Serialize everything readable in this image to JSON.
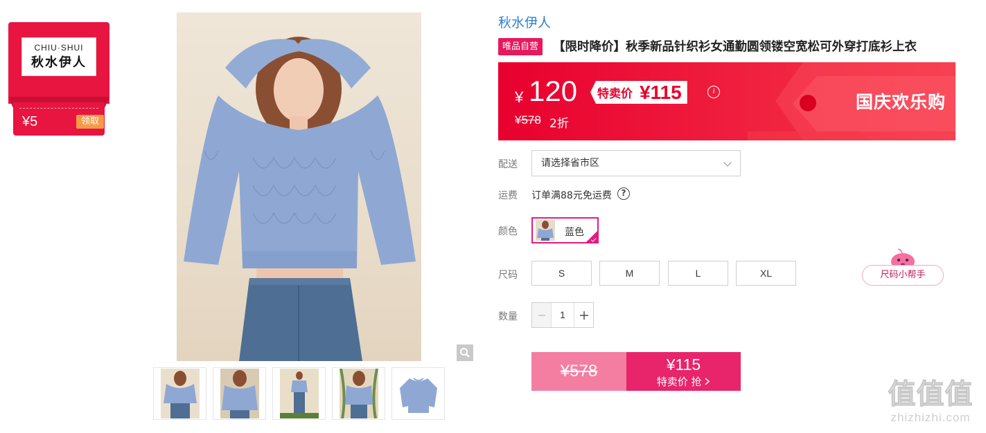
{
  "coupon": {
    "logo_en": "CHIU·SHUI",
    "logo_cn": "秋水伊人",
    "value": "¥5",
    "claim_label": "领取"
  },
  "product": {
    "brand": "秋水伊人",
    "tag": "唯品自营",
    "title": "【限时降价】秋季新品针织衫女通勤圆领镂空宽松可外穿打底衫上衣",
    "price_currency": "¥",
    "price": "120",
    "special_label": "特卖价",
    "special_price": "¥115",
    "original_price": "¥578",
    "discount": "2折",
    "event": "国庆欢乐购"
  },
  "delivery": {
    "label": "配送",
    "placeholder": "请选择省市区"
  },
  "shipping": {
    "label": "运费",
    "text": "订单满88元免运费"
  },
  "color": {
    "label": "颜色",
    "selected": "蓝色"
  },
  "size": {
    "label": "尺码",
    "options": [
      "S",
      "M",
      "L",
      "XL"
    ],
    "helper": "尺码小帮手"
  },
  "quantity": {
    "label": "数量",
    "value": "1"
  },
  "buy": {
    "original": "¥578",
    "price": "¥115",
    "action": "特卖价 抢"
  },
  "watermark": {
    "big": "值值值",
    "small": "zhizhizhi.com"
  },
  "colors": {
    "accent": "#e8246a",
    "banner": "#e8002e",
    "brand_link": "#2c7fd1",
    "coupon_red": "#e7153f",
    "coupon_btn": "#f59a45"
  }
}
